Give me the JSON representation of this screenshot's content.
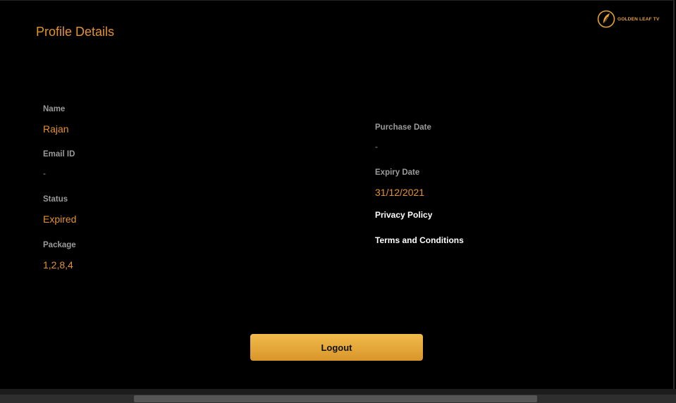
{
  "header": {
    "title": "Profile Details",
    "logo_text": "GOLDEN LEAF TV"
  },
  "left_fields": [
    {
      "label": "Name",
      "value": "Rajan"
    },
    {
      "label": "Email ID",
      "value": "-"
    },
    {
      "label": "Status",
      "value": "Expired"
    },
    {
      "label": "Package",
      "value": "1,2,8,4"
    }
  ],
  "right_fields": [
    {
      "label": "Purchase Date",
      "value": "-"
    },
    {
      "label": "Expiry Date",
      "value": "31/12/2021"
    }
  ],
  "links": {
    "privacy": "Privacy Policy",
    "terms": "Terms and Conditions"
  },
  "logout_label": "Logout",
  "colors": {
    "accent": "#e3922e",
    "button": "#e6a93a",
    "background": "#000000"
  }
}
